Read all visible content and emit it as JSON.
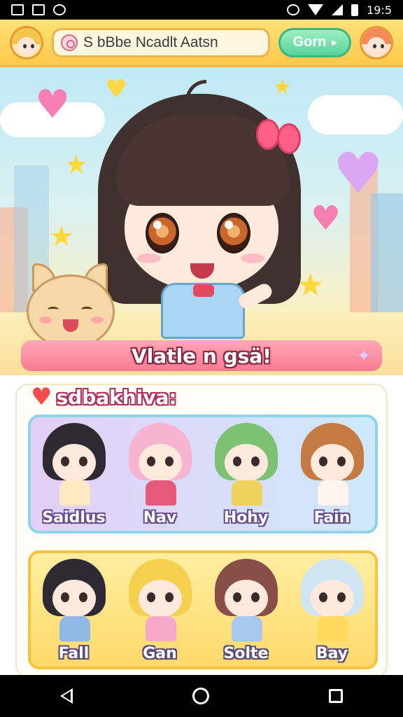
{
  "status_bar": {
    "time": "19:5"
  },
  "app_bar": {
    "search_value": "S bBbe Ncadlt Aatsn",
    "action_label": "Gorn"
  },
  "hero": {
    "banner_text": "Vlatle n gsä!"
  },
  "section": {
    "title": "sdbakhiva:",
    "row1": [
      "Saidlus",
      "Nav",
      "Hohy",
      "Fain"
    ],
    "row2": [
      "Fall",
      "Gan",
      "Solte",
      "Bay"
    ]
  },
  "icons": {
    "status_left": [
      "image-icon",
      "gallery-icon",
      "cloud-icon"
    ],
    "status_right": [
      "alarm-icon",
      "wifi-icon",
      "signal-icon",
      "battery-icon"
    ],
    "nav": [
      "back-icon",
      "home-icon",
      "recent-apps-icon"
    ]
  },
  "colors": {
    "app_bar": "#ffc94a",
    "action_button": "#58d39b",
    "banner": "#f77b93",
    "card_one_border": "#8fd3ea",
    "card_two_border": "#f6c341"
  }
}
